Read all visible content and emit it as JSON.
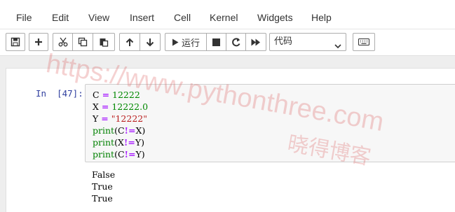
{
  "menubar": {
    "items": [
      "File",
      "Edit",
      "View",
      "Insert",
      "Cell",
      "Kernel",
      "Widgets",
      "Help"
    ]
  },
  "toolbar": {
    "run_label": "运行",
    "cell_type_selected": "代码",
    "icons": [
      "save-icon",
      "plus-icon",
      "scissors-icon",
      "copy-icon",
      "paste-icon",
      "arrow-up-icon",
      "arrow-down-icon",
      "play-icon",
      "stop-icon",
      "restart-icon",
      "fast-forward-icon",
      "keyboard-icon"
    ]
  },
  "cell": {
    "prompt": "In  [47]:",
    "code_lines": [
      {
        "a": "C",
        "op": "=",
        "b": "12222",
        "b_type": "num"
      },
      {
        "a": "X",
        "op": "=",
        "b": "12222.0",
        "b_type": "num"
      },
      {
        "a": "Y",
        "op": "=",
        "b": "\"12222\"",
        "b_type": "str"
      },
      {
        "fn": "print",
        "arg1": "C",
        "op": "!=",
        "arg2": "X"
      },
      {
        "fn": "print",
        "arg1": "X",
        "op": "!=",
        "arg2": "Y"
      },
      {
        "fn": "print",
        "arg1": "C",
        "op": "!=",
        "arg2": "Y"
      }
    ],
    "output_lines": [
      "False",
      "True",
      "True"
    ]
  },
  "watermark": {
    "url": "https://www.pythonthree.com",
    "name": "晓得博客"
  },
  "colors": {
    "prompt": "#303f9f",
    "number": "#008800",
    "operator": "#aa22ff",
    "string": "#ba2121",
    "watermark": "#dc5a5a"
  }
}
